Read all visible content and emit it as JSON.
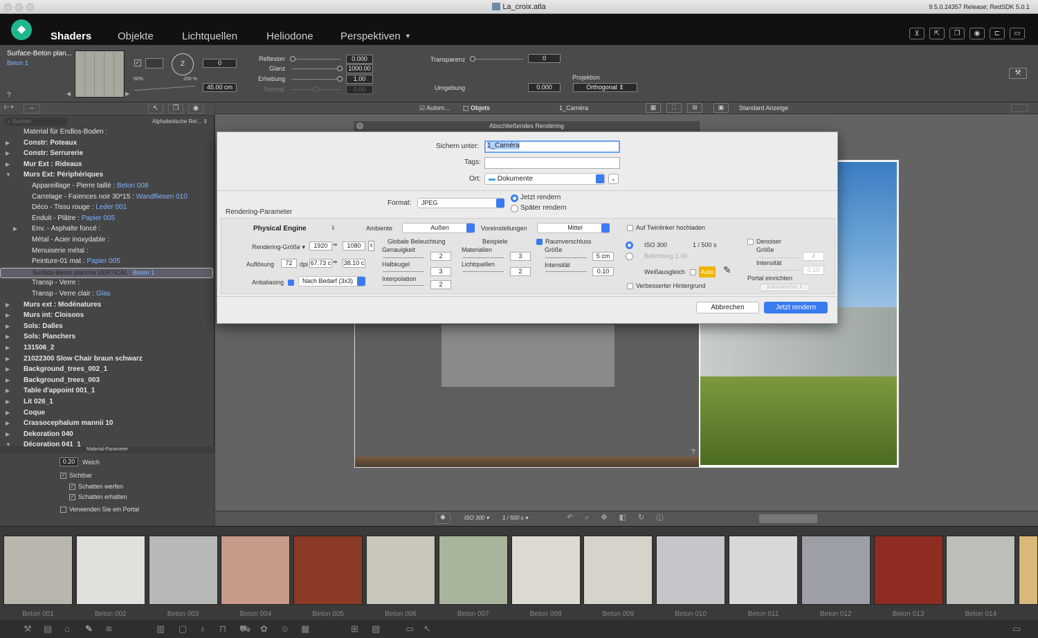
{
  "window": {
    "title": "La_croix.atla",
    "version": "9.5.0.24357 Release; RedSDK 5.0.1"
  },
  "nav": {
    "tabs": [
      "Shaders",
      "Objekte",
      "Lichtquellen",
      "Heliodone",
      "Perspektiven"
    ],
    "active": "Shaders"
  },
  "material": {
    "name": "Surface-Beton plan...",
    "sub": "Beton 1",
    "help": "?",
    "zoom_min": "50%",
    "zoom_max": "200 %",
    "rotation_value": "0",
    "rotation_axis": "Z",
    "size_value": "45.00 cm",
    "reflexion_label": "Reflexion",
    "reflexion_value": "0.000",
    "glanz_label": "Glanz",
    "glanz_value": "1000.00",
    "erhebung_label": "Erhebung",
    "erhebung_value": "1.00",
    "normal_label": "Normal",
    "normal_value": "0.00",
    "transparenz_label": "Transparenz",
    "transparenz_value": "0",
    "umgebung_label": "Umgebung",
    "umgebung_value": "0.000",
    "projektion_label": "Projektion",
    "projektion_value": "Orthogonal"
  },
  "left": {
    "search_placeholder": "Suchen",
    "sort": "Alphabetische Rei...",
    "tree": [
      {
        "text": "Material für Endlos-Boden :",
        "mat": "",
        "indent": 1,
        "bold": false,
        "arrow": ""
      },
      {
        "text": "Constr: Poteaux",
        "mat": "",
        "indent": 1,
        "bold": true,
        "arrow": "▶"
      },
      {
        "text": "Constr: Serrurerie",
        "mat": "",
        "indent": 1,
        "bold": true,
        "arrow": "▶"
      },
      {
        "text": "Mur Ext : Rideaux",
        "mat": "",
        "indent": 1,
        "bold": true,
        "arrow": "▶"
      },
      {
        "text": "Murs Ext: Périphériques",
        "mat": "",
        "indent": 1,
        "bold": true,
        "arrow": "▼"
      },
      {
        "text": "Appareillage - Pierre taillé : ",
        "mat": "Beton 008",
        "indent": 2,
        "bold": false,
        "arrow": ""
      },
      {
        "text": "Carrelage - Faïences noir 30*15 : ",
        "mat": "Wandfliesen 010",
        "indent": 2,
        "bold": false,
        "arrow": ""
      },
      {
        "text": "Déco - Tissu rouge : ",
        "mat": "Leder 001",
        "indent": 2,
        "bold": false,
        "arrow": ""
      },
      {
        "text": "Enduit - Plâtre : ",
        "mat": "Papier 005",
        "indent": 2,
        "bold": false,
        "arrow": ""
      },
      {
        "text": "Env. - Asphalte foncé :",
        "mat": "",
        "indent": 2,
        "bold": false,
        "arrow": "▶"
      },
      {
        "text": "Métal - Acier inoxydable :",
        "mat": "",
        "indent": 2,
        "bold": false,
        "arrow": ""
      },
      {
        "text": "Menuiserie métal :",
        "mat": "",
        "indent": 2,
        "bold": false,
        "arrow": ""
      },
      {
        "text": "Peinture-01 mat : ",
        "mat": "Papier 005",
        "indent": 2,
        "bold": false,
        "arrow": ""
      },
      {
        "text": "Surface-Beton planche VERTICAL : ",
        "mat": "Beton 1",
        "indent": 2,
        "bold": false,
        "arrow": "",
        "selected": true
      },
      {
        "text": "Transp - Verre :",
        "mat": "",
        "indent": 2,
        "bold": false,
        "arrow": ""
      },
      {
        "text": "Transp - Verre clair : ",
        "mat": "Glas",
        "indent": 2,
        "bold": false,
        "arrow": ""
      },
      {
        "text": "Murs ext : Modénatures",
        "mat": "",
        "indent": 1,
        "bold": true,
        "arrow": "▶"
      },
      {
        "text": "Murs int: Cloisons",
        "mat": "",
        "indent": 1,
        "bold": true,
        "arrow": "▶"
      },
      {
        "text": "Sols: Dalles",
        "mat": "",
        "indent": 1,
        "bold": true,
        "arrow": "▶"
      },
      {
        "text": "Sols: Planchers",
        "mat": "",
        "indent": 1,
        "bold": true,
        "arrow": "▶"
      },
      {
        "text": "131506_2",
        "mat": "",
        "indent": 1,
        "bold": true,
        "arrow": "▶"
      },
      {
        "text": "21022300 Slow Chair braun schwarz",
        "mat": "",
        "indent": 1,
        "bold": true,
        "arrow": "▶"
      },
      {
        "text": "Background_trees_002_1",
        "mat": "",
        "indent": 1,
        "bold": true,
        "arrow": "▶"
      },
      {
        "text": "Background_trees_003",
        "mat": "",
        "indent": 1,
        "bold": true,
        "arrow": "▶"
      },
      {
        "text": "Table d'appoint 001_1",
        "mat": "",
        "indent": 1,
        "bold": true,
        "arrow": "▶"
      },
      {
        "text": "Lit 026_1",
        "mat": "",
        "indent": 1,
        "bold": true,
        "arrow": "▶"
      },
      {
        "text": "Coque",
        "mat": "",
        "indent": 1,
        "bold": true,
        "arrow": "▶"
      },
      {
        "text": "Crassocephalum mannii 10",
        "mat": "",
        "indent": 1,
        "bold": true,
        "arrow": "▶"
      },
      {
        "text": "Dekoration 040",
        "mat": "",
        "indent": 1,
        "bold": true,
        "arrow": "▶"
      },
      {
        "text": "Décoration 041_1",
        "mat": "",
        "indent": 1,
        "bold": true,
        "arrow": "▼"
      }
    ],
    "params_title": "Material-Parameter",
    "weich_value": "0.20",
    "weich_label": "Weich",
    "sichtbar": "Sichtbar",
    "schatten_werfen": "Schatten werfen",
    "schatten_erhalten": "Schatten erhalten",
    "portal": "Verwenden Sie ein Portal"
  },
  "viewport": {
    "autom": "Autom...",
    "objets": "Objets",
    "camera": "1_Caméra",
    "display": "Standard Anzeige",
    "help": "?",
    "iso": "ISO 300",
    "shutter": "1 / 500 s"
  },
  "dialog": {
    "header": "Abschließendes Rendering",
    "save_label": "Sichern unter:",
    "save_value": "1_Caméra",
    "tags_label": "Tags:",
    "tags_value": "",
    "ort_label": "Ort:",
    "ort_value": "Dokumente",
    "format_label": "Format:",
    "format_value": "JPEG",
    "render_now": "Jetzt rendern",
    "render_later": "Später rendern",
    "params_title": "Rendering-Parameter",
    "engine": "Physical Engine",
    "ambiente_label": "Ambiente",
    "ambiente_value": "Außen",
    "voreinst_label": "Voreinstellungen",
    "voreinst_value": "Mittel",
    "twinlinker": "Auf Twinlinker hochladen",
    "size_label": "Rendering-Größe",
    "width": "1920",
    "height": "1080",
    "res_label": "Auflösung",
    "dpi": "72",
    "dpi_unit": "dpi",
    "res_w": "67.73 c",
    "res_h": "38.10 c",
    "aa_label": "Antialiasing",
    "aa_value": "Nach Bedarf (3x3)",
    "global_title": "Globale Beleuchtung",
    "genauigkeit": "Genauigkeit",
    "genauigkeit_value": "2",
    "halbkugel": "Halbkugel",
    "halbkugel_value": "3",
    "interpolation": "Interpolation",
    "interpolation_value": "2",
    "beispiele_title": "Beispiele",
    "materialien": "Materialien",
    "materialien_value": "3",
    "lichtquellen": "Lichtquellen",
    "lichtquellen_value": "2",
    "raum_label": "Raumverschluss",
    "groesse": "Größe",
    "groesse_value": "5 cm",
    "intensitaet": "Intensität",
    "intensitaet_value": "0.10",
    "iso": "ISO 300",
    "shutter": "1 / 500 s",
    "belichtung": "Belichtung 1.00",
    "weiss": "Weißausgleich",
    "auto": "Auto",
    "hintergrund": "Verbesserter Hintergrund",
    "denoiser": "Denoiser",
    "den_groesse": "Größe",
    "den_groesse_value": "4",
    "den_intens": "Intensität",
    "den_intens_value": "0.10",
    "portal": "Portal einrichten",
    "portal_value": "Automatischer",
    "cancel": "Abbrechen",
    "ok": "Jetzt rendern"
  },
  "thumbs": [
    {
      "label": "Beton 001",
      "color": "#b9b7ad"
    },
    {
      "label": "Beton 002",
      "color": "#e2e0dc"
    },
    {
      "label": "Beton 003",
      "color": "#b7b9b6"
    },
    {
      "label": "Beton 004",
      "color": "#c79a8a"
    },
    {
      "label": "Beton 005",
      "color": "#8a3a26"
    },
    {
      "label": "Beton 006",
      "color": "#c9c7bc"
    },
    {
      "label": "Beton 007",
      "color": "#a9b49c"
    },
    {
      "label": "Beton 008",
      "color": "#dcdad2"
    },
    {
      "label": "Beton 009",
      "color": "#d6d3ca"
    },
    {
      "label": "Beton 010",
      "color": "#c5c6ca"
    },
    {
      "label": "Beton 011",
      "color": "#d8d8d6"
    },
    {
      "label": "Beton 012",
      "color": "#9ca0a6"
    },
    {
      "label": "Beton 013",
      "color": "#8f2c22"
    },
    {
      "label": "Beton 014",
      "color": "#bdbfbb"
    }
  ]
}
